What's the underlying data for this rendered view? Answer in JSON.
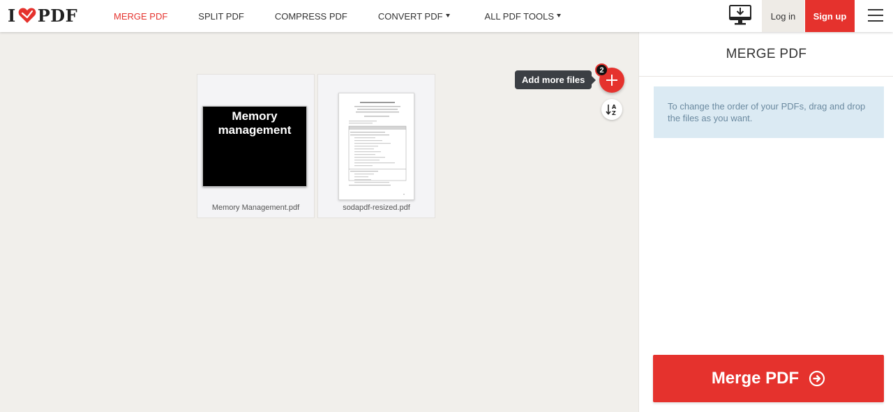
{
  "header": {
    "logo_left": "I",
    "logo_right": "PDF",
    "nav": [
      {
        "label": "MERGE PDF",
        "active": true,
        "dropdown": false
      },
      {
        "label": "SPLIT PDF",
        "active": false,
        "dropdown": false
      },
      {
        "label": "COMPRESS PDF",
        "active": false,
        "dropdown": false
      },
      {
        "label": "CONVERT PDF",
        "active": false,
        "dropdown": true
      },
      {
        "label": "ALL PDF TOOLS",
        "active": false,
        "dropdown": true
      }
    ],
    "login_label": "Log in",
    "signup_label": "Sign up"
  },
  "workspace": {
    "files": [
      {
        "name": "Memory Management.pdf",
        "thumb_title": "Memory management"
      },
      {
        "name": "sodapdf-resized.pdf"
      }
    ],
    "add_more_tooltip": "Add more files",
    "file_count": "2"
  },
  "sidebar": {
    "title": "MERGE PDF",
    "info": "To change the order of your PDFs, drag and drop the files as you want.",
    "merge_button": "Merge PDF"
  },
  "colors": {
    "brand_red": "#e5322d",
    "workspace_bg": "#f1efeb",
    "info_bg": "#dbeaf3",
    "info_text": "#6b8aa0"
  },
  "icons": [
    "heart-logo-icon",
    "desktop-download-icon",
    "hamburger-menu-icon",
    "plus-icon",
    "sort-az-icon",
    "arrow-circle-right-icon",
    "caret-down-icon"
  ]
}
